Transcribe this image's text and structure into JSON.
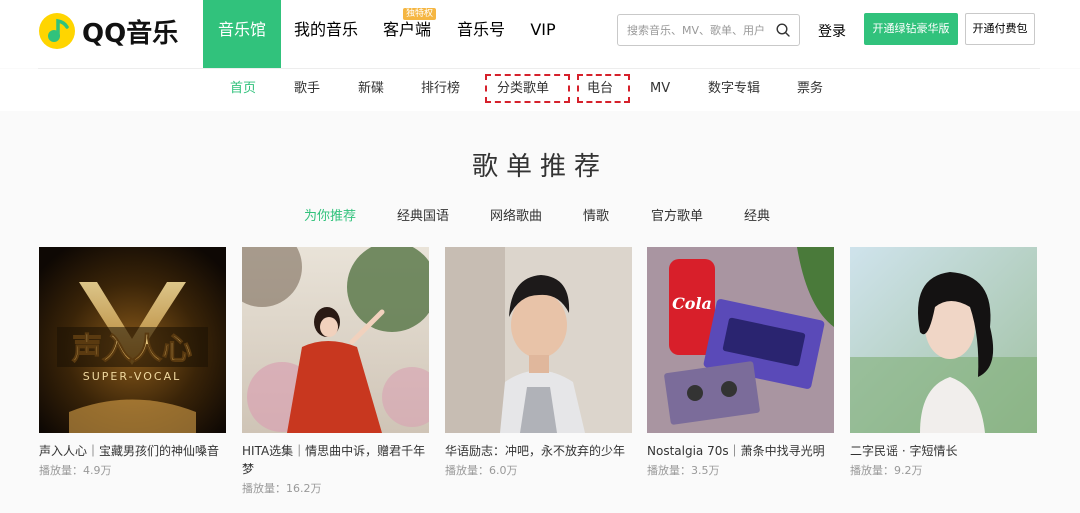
{
  "logo": {
    "text": "QQ音乐"
  },
  "mainnav": [
    {
      "label": "音乐馆"
    },
    {
      "label": "我的音乐"
    },
    {
      "label": "客户端",
      "badge": "独特权"
    },
    {
      "label": "音乐号"
    },
    {
      "label": "VIP"
    }
  ],
  "search": {
    "placeholder": "搜索音乐、MV、歌单、用户"
  },
  "header": {
    "login": "登录",
    "green_button": "开通绿钻豪华版",
    "outline_button": "开通付费包"
  },
  "subnav": [
    {
      "label": "首页"
    },
    {
      "label": "歌手"
    },
    {
      "label": "新碟"
    },
    {
      "label": "排行榜"
    },
    {
      "label": "分类歌单"
    },
    {
      "label": "电台"
    },
    {
      "label": "MV"
    },
    {
      "label": "数字专辑"
    },
    {
      "label": "票务"
    }
  ],
  "section": {
    "title": "歌单推荐",
    "tabs": [
      {
        "label": "为你推荐"
      },
      {
        "label": "经典国语"
      },
      {
        "label": "网络歌曲"
      },
      {
        "label": "情歌"
      },
      {
        "label": "官方歌单"
      },
      {
        "label": "经典"
      }
    ]
  },
  "playlists": [
    {
      "title": "声入人心｜宝藏男孩们的神仙嗓音",
      "plays": "播放量：4.9万",
      "cover_text": "声入人心",
      "cover_sub": "SUPER-VOCAL"
    },
    {
      "title": "HITA选集｜情思曲中诉，赠君千年梦",
      "plays": "播放量：16.2万"
    },
    {
      "title": "华语励志：冲吧，永不放弃的少年",
      "plays": "播放量：6.0万"
    },
    {
      "title": "Nostalgia 70s｜萧条中找寻光明",
      "plays": "播放量：3.5万",
      "cover_text": "Cola"
    },
    {
      "title": "二字民谣 · 字短情长",
      "plays": "播放量：9.2万"
    }
  ],
  "colors": {
    "accent": "#31c27c",
    "highlight_box": "#d6202b",
    "badge": "#f5b642"
  }
}
